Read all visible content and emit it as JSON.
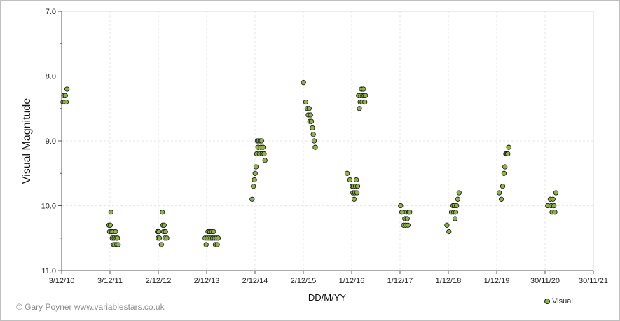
{
  "credit": "© Gary Poyner www.variablestars.co.uk",
  "chart_data": {
    "type": "scatter",
    "title": "",
    "xlabel": "DD/M/YY",
    "ylabel": "Visual Magnitude",
    "y_inverted": true,
    "ylim": [
      7.0,
      11.0
    ],
    "y_ticks": [
      "7.0",
      "8.0",
      "9.0",
      "10.0",
      "11.0"
    ],
    "x_ticks": [
      "3/12/10",
      "3/12/11",
      "2/12/12",
      "2/12/13",
      "2/12/14",
      "2/12/15",
      "1/12/16",
      "1/12/17",
      "1/12/18",
      "1/12/19",
      "30/11/20",
      "30/11/21"
    ],
    "x_domain": [
      "2010-12-03",
      "2021-11-30"
    ],
    "grid": true,
    "legend_position": "bottom-right",
    "marker_color": "#8fb34a",
    "series": [
      {
        "name": "Visual",
        "points": [
          [
            "2010-12-13",
            8.4
          ],
          [
            "2010-12-19",
            8.3
          ],
          [
            "2010-12-25",
            8.4
          ],
          [
            "2010-12-31",
            8.3
          ],
          [
            "2011-01-06",
            8.4
          ],
          [
            "2011-01-12",
            8.2
          ],
          [
            "2011-11-25",
            10.3
          ],
          [
            "2011-11-30",
            10.4
          ],
          [
            "2011-12-05",
            10.3
          ],
          [
            "2011-12-10",
            10.1
          ],
          [
            "2011-12-15",
            10.4
          ],
          [
            "2011-12-20",
            10.5
          ],
          [
            "2011-12-25",
            10.4
          ],
          [
            "2011-12-30",
            10.6
          ],
          [
            "2012-01-04",
            10.5
          ],
          [
            "2012-01-09",
            10.6
          ],
          [
            "2012-01-14",
            10.4
          ],
          [
            "2012-01-19",
            10.5
          ],
          [
            "2012-01-24",
            10.6
          ],
          [
            "2012-01-29",
            10.5
          ],
          [
            "2012-02-03",
            10.6
          ],
          [
            "2012-11-25",
            10.4
          ],
          [
            "2012-11-30",
            10.5
          ],
          [
            "2012-12-05",
            10.4
          ],
          [
            "2012-12-10",
            10.5
          ],
          [
            "2012-12-25",
            10.6
          ],
          [
            "2013-01-01",
            10.1
          ],
          [
            "2013-01-05",
            10.3
          ],
          [
            "2013-01-10",
            10.4
          ],
          [
            "2013-01-15",
            10.3
          ],
          [
            "2013-01-20",
            10.5
          ],
          [
            "2013-01-25",
            10.4
          ],
          [
            "2013-02-04",
            10.5
          ],
          [
            "2013-11-20",
            10.5
          ],
          [
            "2013-11-28",
            10.6
          ],
          [
            "2013-12-05",
            10.5
          ],
          [
            "2013-12-12",
            10.4
          ],
          [
            "2013-12-19",
            10.5
          ],
          [
            "2013-12-26",
            10.4
          ],
          [
            "2014-01-02",
            10.5
          ],
          [
            "2014-01-09",
            10.4
          ],
          [
            "2014-01-16",
            10.5
          ],
          [
            "2014-01-23",
            10.4
          ],
          [
            "2014-01-30",
            10.5
          ],
          [
            "2014-02-06",
            10.6
          ],
          [
            "2014-02-13",
            10.5
          ],
          [
            "2014-02-20",
            10.6
          ],
          [
            "2014-02-27",
            10.5
          ],
          [
            "2014-11-10",
            9.9
          ],
          [
            "2014-11-20",
            9.7
          ],
          [
            "2014-11-27",
            9.6
          ],
          [
            "2014-12-03",
            9.5
          ],
          [
            "2014-12-10",
            9.4
          ],
          [
            "2014-12-15",
            9.2
          ],
          [
            "2014-12-20",
            9.0
          ],
          [
            "2014-12-25",
            9.1
          ],
          [
            "2014-12-30",
            9.0
          ],
          [
            "2015-01-05",
            9.2
          ],
          [
            "2015-01-10",
            9.0
          ],
          [
            "2015-01-15",
            9.1
          ],
          [
            "2015-01-20",
            9.0
          ],
          [
            "2015-01-25",
            9.2
          ],
          [
            "2015-02-01",
            9.1
          ],
          [
            "2015-02-08",
            9.2
          ],
          [
            "2015-02-15",
            9.3
          ],
          [
            "2015-12-03",
            8.1
          ],
          [
            "2015-12-20",
            8.4
          ],
          [
            "2015-12-31",
            8.5
          ],
          [
            "2016-01-08",
            8.6
          ],
          [
            "2016-01-15",
            8.5
          ],
          [
            "2016-01-20",
            8.7
          ],
          [
            "2016-01-25",
            8.6
          ],
          [
            "2016-02-01",
            8.7
          ],
          [
            "2016-02-08",
            8.8
          ],
          [
            "2016-02-15",
            8.9
          ],
          [
            "2016-02-22",
            9.0
          ],
          [
            "2016-03-01",
            9.1
          ],
          [
            "2016-10-28",
            9.5
          ],
          [
            "2016-11-18",
            9.6
          ],
          [
            "2016-12-05",
            9.7
          ],
          [
            "2016-12-10",
            9.8
          ],
          [
            "2016-12-15",
            9.7
          ],
          [
            "2016-12-20",
            9.9
          ],
          [
            "2016-12-25",
            9.8
          ],
          [
            "2016-12-30",
            9.7
          ],
          [
            "2017-01-05",
            9.6
          ],
          [
            "2017-01-10",
            9.8
          ],
          [
            "2017-01-15",
            9.7
          ],
          [
            "2017-01-22",
            8.3
          ],
          [
            "2017-01-28",
            8.5
          ],
          [
            "2017-02-03",
            8.4
          ],
          [
            "2017-02-08",
            8.3
          ],
          [
            "2017-02-13",
            8.2
          ],
          [
            "2017-02-18",
            8.4
          ],
          [
            "2017-02-23",
            8.3
          ],
          [
            "2017-02-28",
            8.2
          ],
          [
            "2017-03-05",
            8.3
          ],
          [
            "2017-03-10",
            8.4
          ],
          [
            "2017-03-15",
            8.3
          ],
          [
            "2017-12-05",
            10.0
          ],
          [
            "2017-12-15",
            10.1
          ],
          [
            "2017-12-28",
            10.3
          ],
          [
            "2018-01-06",
            10.2
          ],
          [
            "2018-01-12",
            10.3
          ],
          [
            "2018-01-18",
            10.1
          ],
          [
            "2018-01-24",
            10.2
          ],
          [
            "2018-01-30",
            10.3
          ],
          [
            "2018-02-05",
            10.1
          ],
          [
            "2018-02-12",
            10.1
          ],
          [
            "2018-11-20",
            10.3
          ],
          [
            "2018-12-05",
            10.4
          ],
          [
            "2018-12-25",
            10.1
          ],
          [
            "2019-01-05",
            10.0
          ],
          [
            "2019-01-10",
            10.1
          ],
          [
            "2019-01-15",
            10.0
          ],
          [
            "2019-01-20",
            10.2
          ],
          [
            "2019-01-25",
            10.1
          ],
          [
            "2019-02-01",
            10.0
          ],
          [
            "2019-02-10",
            9.9
          ],
          [
            "2019-02-20",
            9.8
          ],
          [
            "2019-12-20",
            9.8
          ],
          [
            "2020-01-05",
            9.9
          ],
          [
            "2020-01-15",
            9.7
          ],
          [
            "2020-01-25",
            9.5
          ],
          [
            "2020-02-01",
            9.4
          ],
          [
            "2020-02-08",
            9.2
          ],
          [
            "2020-02-15",
            9.2
          ],
          [
            "2020-02-22",
            9.2
          ],
          [
            "2020-03-01",
            9.1
          ],
          [
            "2020-12-20",
            10.0
          ],
          [
            "2021-01-08",
            9.9
          ],
          [
            "2021-01-15",
            10.0
          ],
          [
            "2021-01-22",
            10.1
          ],
          [
            "2021-01-29",
            9.9
          ],
          [
            "2021-02-05",
            10.0
          ],
          [
            "2021-02-12",
            10.1
          ],
          [
            "2021-02-20",
            9.8
          ]
        ]
      }
    ]
  }
}
